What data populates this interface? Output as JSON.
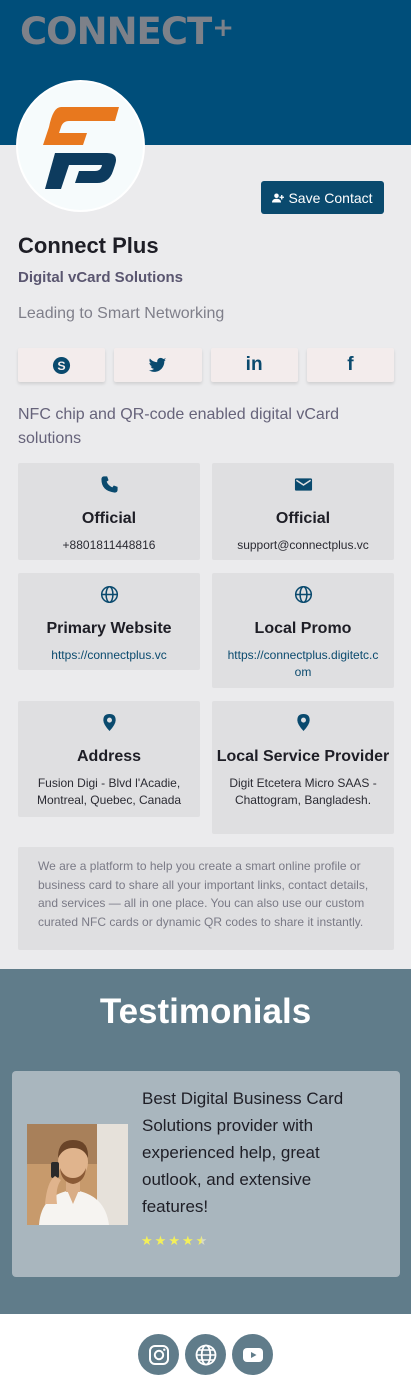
{
  "brand": {
    "logo_text": "CONNECT",
    "logo_plus": "+"
  },
  "profile": {
    "name": "Connect Plus",
    "subtitle": "Digital vCard Solutions",
    "tagline": "Leading to Smart Networking",
    "save_contact_label": "Save Contact",
    "description": "NFC chip and QR-code enabled digital vCard solutions"
  },
  "socials": [
    {
      "icon": "skype-icon"
    },
    {
      "icon": "twitter-icon"
    },
    {
      "icon": "linkedin-icon",
      "glyph": "in"
    },
    {
      "icon": "facebook-icon",
      "glyph": "f"
    }
  ],
  "contacts": [
    {
      "icon": "phone-icon",
      "title": "Official",
      "value": "+8801811448816"
    },
    {
      "icon": "mail-icon",
      "title": "Official",
      "value": "support@connectplus.vc"
    },
    {
      "icon": "globe-icon",
      "title": "Primary Website",
      "value": "https://connectplus.vc"
    },
    {
      "icon": "globe-icon",
      "title": "Local Promo",
      "value": "https://connectplus.digitetc.com"
    },
    {
      "icon": "location-icon",
      "title": "Address",
      "value": "Fusion Digi - Blvd l'Acadie, Montreal, Quebec, Canada"
    },
    {
      "icon": "location-icon",
      "title": "Local Service Provider",
      "value": "Digit Etcetera Micro SAAS - Chattogram, Bangladesh."
    }
  ],
  "about": "We are a platform to help you create a smart online profile or business card to share all your important links, contact details, and services — all in one place. You can also use our custom curated NFC cards or dynamic QR codes to share it instantly.",
  "testimonials": {
    "heading": "Testimonials",
    "items": [
      {
        "text": "Best Digital Business Card Solutions provider with experienced help, great outlook, and extensive features!",
        "rating": 4.5
      }
    ]
  },
  "footer": {
    "icons": [
      "instagram-icon",
      "globe-icon",
      "youtube-icon"
    ]
  },
  "colors": {
    "header": "#004e7a",
    "accent": "#0a4a6e",
    "logo_orange": "#e8781e",
    "testimonials_bg": "#607c8a",
    "star": "#f3ef5a"
  }
}
